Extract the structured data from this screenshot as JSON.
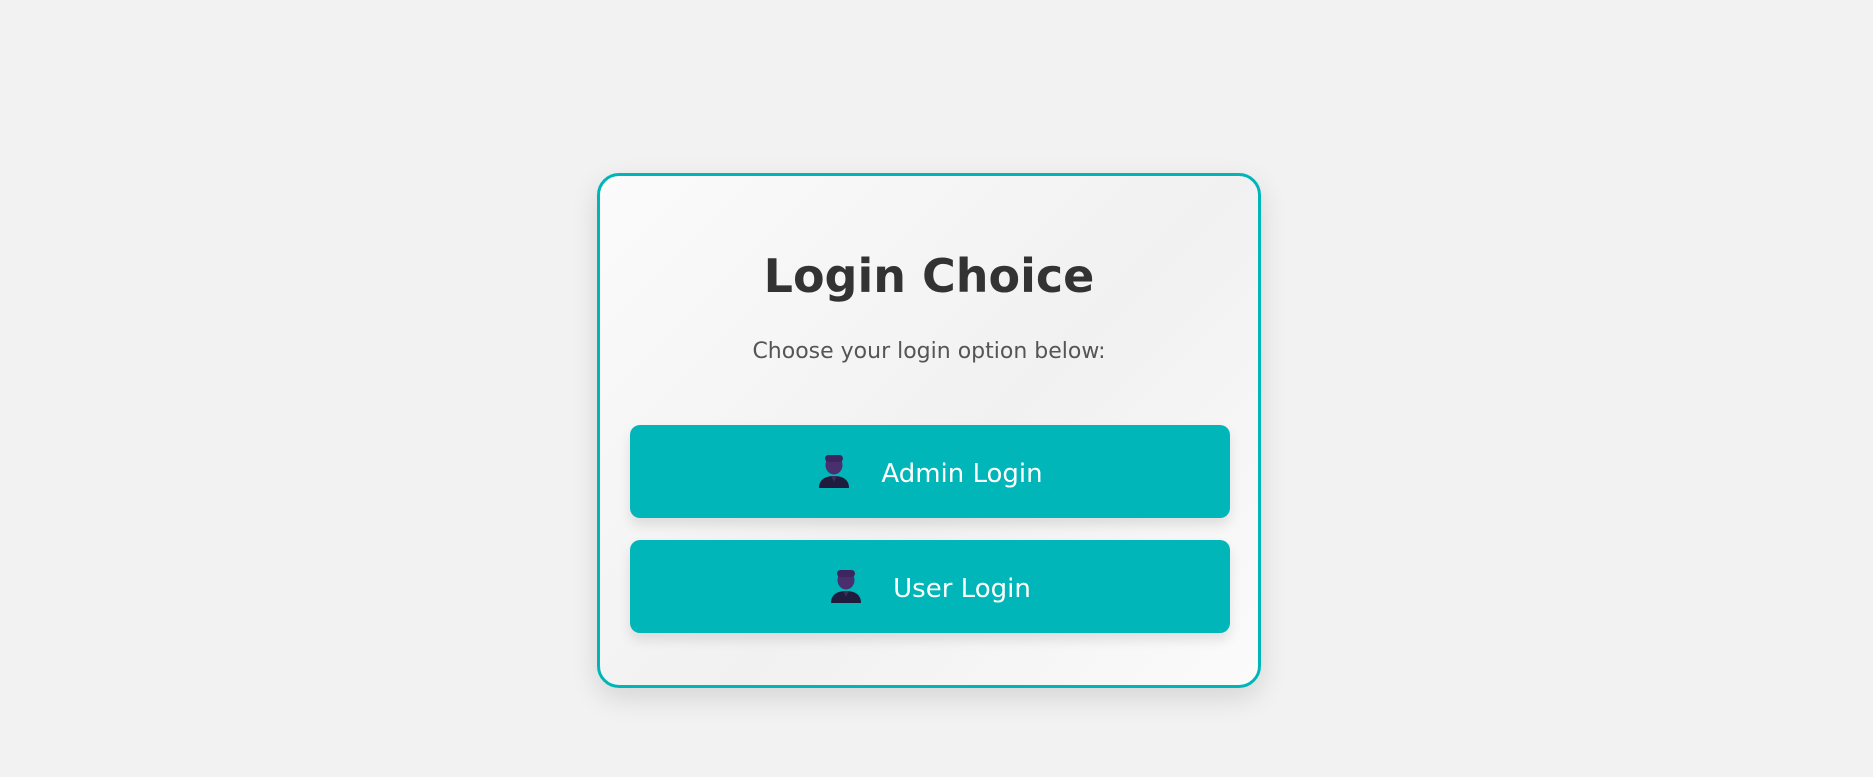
{
  "card": {
    "title": "Login Choice",
    "subtitle": "Choose your login option below:"
  },
  "buttons": {
    "admin": {
      "label": "Admin Login",
      "icon": "user-icon"
    },
    "user": {
      "label": "User Login",
      "icon": "user-icon"
    }
  },
  "colors": {
    "background": "#f2f2f2",
    "accent": "#00b6b8",
    "title_text": "#333333",
    "subtitle_text": "#555555",
    "button_text": "#ffffff",
    "icon_head": "#4a2f6e",
    "icon_body": "#1f1c3d"
  }
}
